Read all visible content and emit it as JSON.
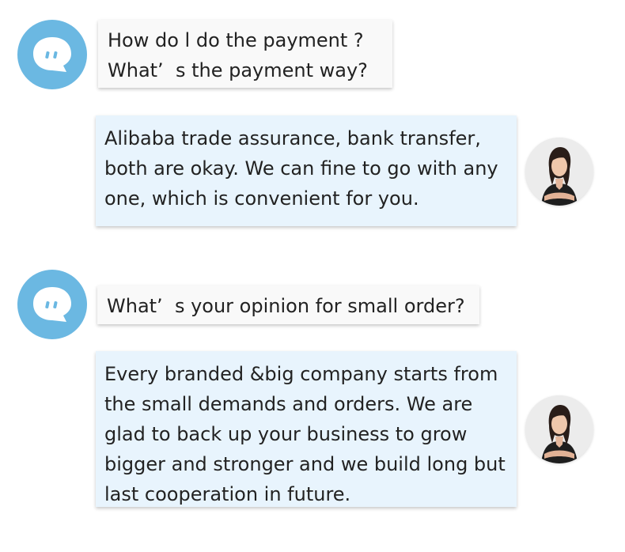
{
  "icons": {
    "bot_avatar": "chat-bubble-icon",
    "agent_avatar": "woman-portrait"
  },
  "colors": {
    "bot_avatar_bg": "#6bb8e2",
    "question_bubble_bg": "#f9f9f9",
    "answer_bubble_bg": "#e8f4fd"
  },
  "messages": [
    {
      "sender": "customer",
      "text": "How do l do the payment ?\nWhat’  s the payment way?"
    },
    {
      "sender": "agent",
      "text": "Alibaba trade assurance, bank transfer,\nboth are okay. We can fine to go with any\none, which is convenient for you."
    },
    {
      "sender": "customer",
      "text": "What’  s your opinion for small order?"
    },
    {
      "sender": "agent",
      "text": "Every branded &big company starts from\nthe small demands and orders. We are\nglad to back up your business to grow\nbigger and stronger and we build long but\nlast cooperation in future."
    }
  ]
}
